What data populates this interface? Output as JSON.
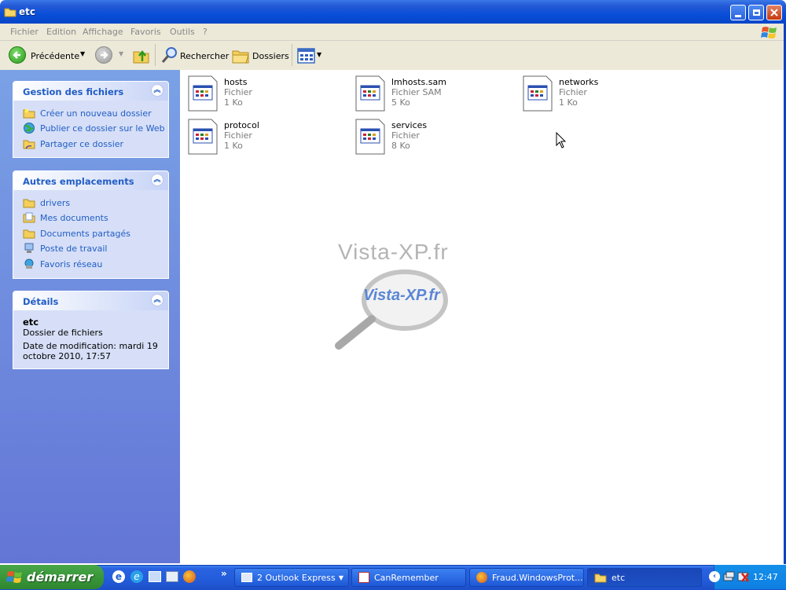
{
  "window": {
    "title": "etc"
  },
  "menu": [
    "Fichier",
    "Edition",
    "Affichage",
    "Favoris",
    "Outils",
    "?"
  ],
  "toolbar": {
    "back_label": "Précédente",
    "search_label": "Rechercher",
    "folders_label": "Dossiers"
  },
  "left_pane": {
    "file_tasks": {
      "title": "Gestion des fichiers",
      "items": [
        "Créer un nouveau dossier",
        "Publier ce dossier sur le Web",
        "Partager ce dossier"
      ]
    },
    "other_places": {
      "title": "Autres emplacements",
      "items": [
        "drivers",
        "Mes documents",
        "Documents partagés",
        "Poste de travail",
        "Favoris réseau"
      ]
    },
    "details": {
      "title": "Détails",
      "name": "etc",
      "kind": "Dossier de fichiers",
      "modified_line1": "Date de modification: mardi 19",
      "modified_line2": "octobre 2010, 17:57"
    }
  },
  "files": [
    {
      "name": "hosts",
      "type": "Fichier",
      "size": "1 Ko"
    },
    {
      "name": "lmhosts.sam",
      "type": "Fichier SAM",
      "size": "5 Ko"
    },
    {
      "name": "networks",
      "type": "Fichier",
      "size": "1 Ko"
    },
    {
      "name": "protocol",
      "type": "Fichier",
      "size": "1 Ko"
    },
    {
      "name": "services",
      "type": "Fichier",
      "size": "8 Ko"
    }
  ],
  "watermark": {
    "text1": "Vista-XP.fr",
    "text2": "Vista-XP.fr"
  },
  "taskbar": {
    "start_label": "démarrer",
    "quicklaunch_more": "»",
    "buttons": [
      "2 Outlook Express",
      "CanRemember",
      "Fraud.WindowsProt...",
      "etc"
    ],
    "clock": "12:47"
  },
  "colors": {
    "titlebar": "#0a4fd8",
    "taskpane_link": "#215dc6",
    "start_green": "#3c9a3c"
  }
}
